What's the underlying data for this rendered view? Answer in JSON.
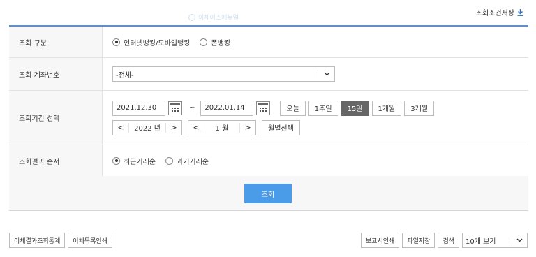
{
  "watermark": "이체이스에뉴얼",
  "top_save": {
    "label": "조회조건저장"
  },
  "form": {
    "rows": {
      "type": {
        "label": "조회 구분",
        "options": [
          {
            "label": "인터넷뱅킹/모바일뱅킹",
            "selected": true
          },
          {
            "label": "폰뱅킹",
            "selected": false
          }
        ]
      },
      "account": {
        "label": "조회 계좌번호",
        "selected": "-전체-"
      },
      "period": {
        "label": "조회기간 선택",
        "start": "2021.12.30",
        "tilde": "~",
        "end": "2022.01.14",
        "quick": [
          {
            "label": "오늘",
            "active": false
          },
          {
            "label": "1주일",
            "active": false
          },
          {
            "label": "15일",
            "active": true
          },
          {
            "label": "1개월",
            "active": false
          },
          {
            "label": "3개월",
            "active": false
          }
        ],
        "year_text": "2022 년",
        "month_text": "1 월",
        "monthly_select": "월별선택",
        "prev": "<",
        "next": ">"
      },
      "order": {
        "label": "조회결과 순서",
        "options": [
          {
            "label": "최근거래순",
            "selected": true
          },
          {
            "label": "과거거래순",
            "selected": false
          }
        ]
      }
    }
  },
  "search_button": "조회",
  "bottom": {
    "left": [
      "이체결과조회통계",
      "이체목록인쇄"
    ],
    "right": [
      "보고서인쇄",
      "파일저장",
      "검색"
    ],
    "page_size": "10개 보기"
  },
  "colors": {
    "accent": "#4a9be8",
    "top_rule": "#5b8fd0",
    "active_btn": "#666666"
  }
}
